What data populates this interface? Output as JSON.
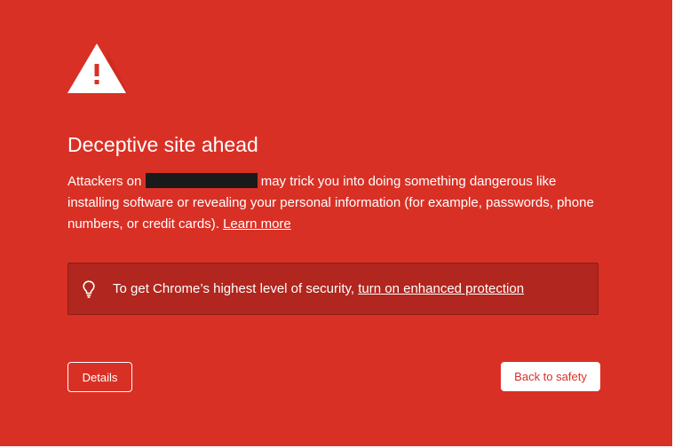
{
  "colors": {
    "page_background": "#d93025",
    "enhanced_box_background": "#b1261e",
    "text": "#ffffff",
    "redaction": "#1a1a1a"
  },
  "icons": {
    "warning": "warning-triangle-icon",
    "tip": "lightbulb-icon"
  },
  "interstitial": {
    "title": "Deceptive site ahead",
    "body_prefix": "Attackers on",
    "body_suffix": "may trick you into doing something dangerous like installing software or revealing your personal information (for example, passwords, phone numbers, or credit cards).",
    "learn_more": "Learn more"
  },
  "enhanced_protection": {
    "text": "To get Chrome’s highest level of security,",
    "link": "turn on enhanced protection"
  },
  "buttons": {
    "details": "Details",
    "back_to_safety": "Back to safety"
  }
}
